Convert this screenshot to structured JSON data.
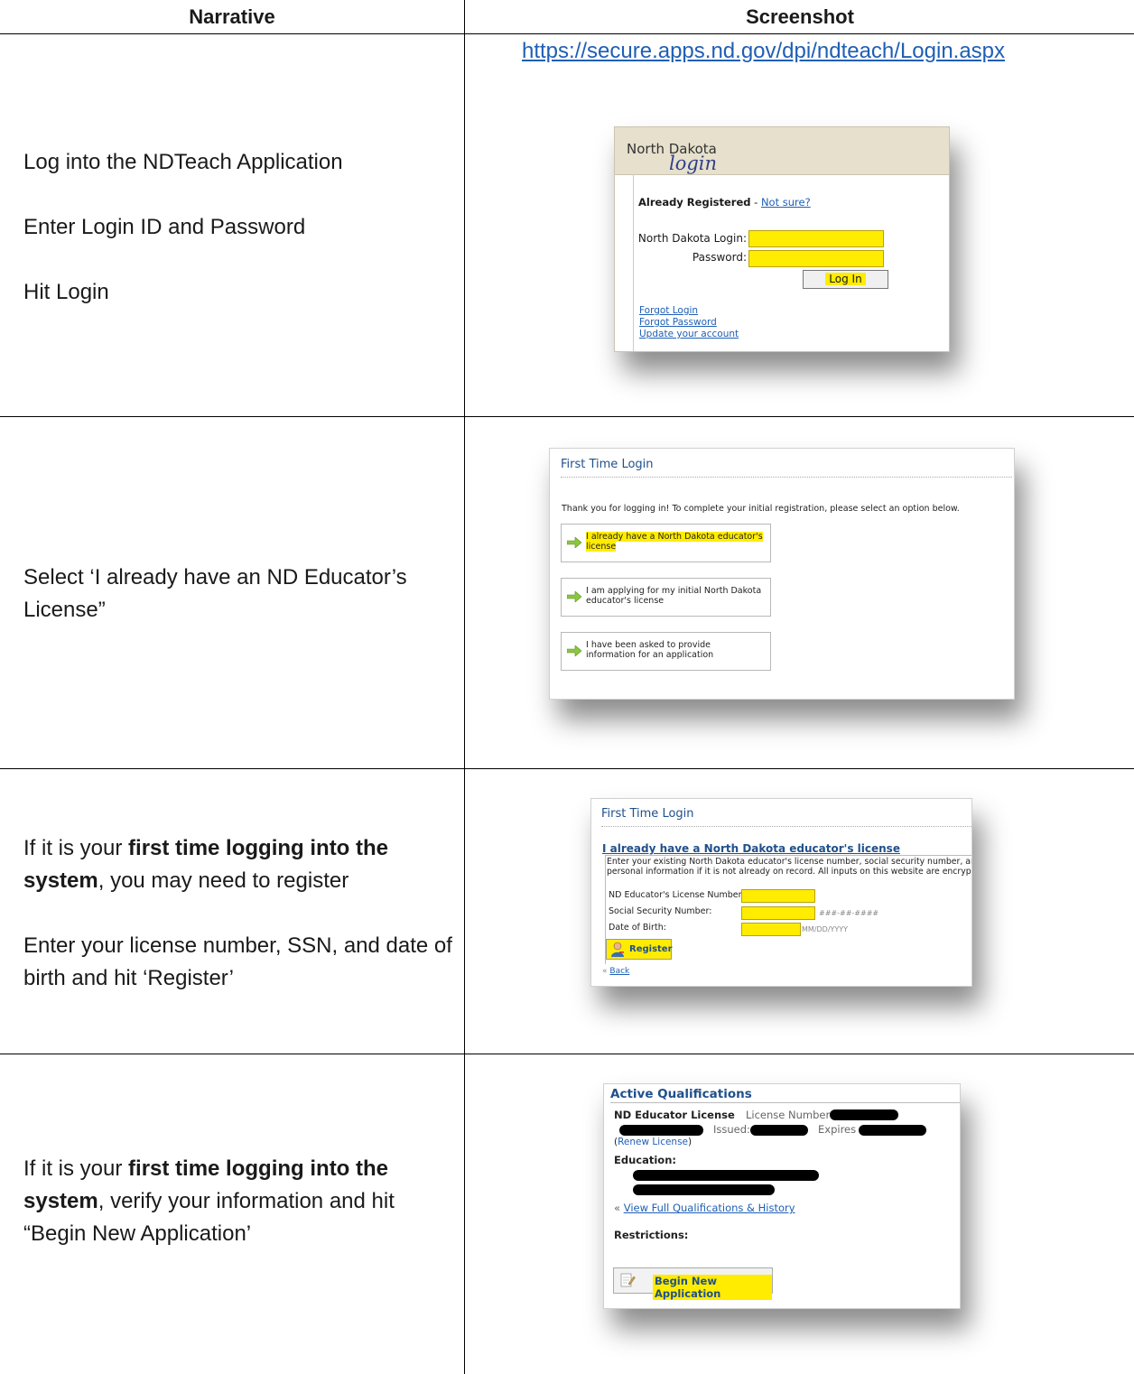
{
  "table": {
    "col_narrative": "Narrative",
    "col_screenshot": "Screenshot"
  },
  "rows": [
    {
      "narrative": [
        "Log into the NDTeach Application",
        "Enter Login ID and Password",
        "Hit Login"
      ],
      "url": "https://secure.apps.nd.gov/dpi/ndteach/Login.aspx"
    },
    {
      "narrative": "Select ‘I already have an ND Educator’s License”"
    },
    {
      "narrative_p1_pre": "If it is your ",
      "narrative_p1_bold": "first time logging into the system",
      "narrative_p1_post": ", you may need to register",
      "narrative_p2": "Enter your license number, SSN, and date of birth and hit ‘Register’"
    },
    {
      "narrative_pre": "If it is your ",
      "narrative_bold": "first time logging into the system",
      "narrative_post": ", verify your information and hit “Begin New Application’"
    }
  ],
  "login_shot": {
    "brand_line1": "North Dakota",
    "brand_line2": "login",
    "already_registered": "Already Registered",
    "separator": " - ",
    "not_sure": "Not sure?",
    "login_label": "North Dakota Login:",
    "password_label": "Password:",
    "login_button": "Log In",
    "forgot_login": "Forgot Login",
    "forgot_password": "Forgot Password",
    "update_account": "Update your account"
  },
  "first_login_shot": {
    "title": "First Time Login",
    "intro": "Thank you for logging in! To complete your initial registration, please select an option below.",
    "options": [
      {
        "line1": "I already have a North Dakota educator's",
        "line2": "license",
        "highlighted": true
      },
      {
        "line1": "I am applying for my initial North Dakota",
        "line2": "educator's license",
        "highlighted": false
      },
      {
        "line1": "I have been asked to provide",
        "line2": "information for an application",
        "highlighted": false
      }
    ]
  },
  "register_shot": {
    "title": "First Time Login",
    "section": "I already have a North Dakota educator's license",
    "desc_line1": "Enter your existing North Dakota educator's license number, social security number, an",
    "desc_line2": "personal information if it is not already on record. All inputs on this website are encryp",
    "license_label": "ND Educator's License Number:",
    "ssn_label": "Social Security Number:",
    "ssn_hint": "###-##-####",
    "dob_label": "Date of Birth:",
    "dob_hint": "MM/DD/YYYY",
    "register_button": "Register",
    "back_chevron": "«",
    "back_link": "Back"
  },
  "qualifications_shot": {
    "title": "Active Qualifications",
    "license_name": "ND Educator License",
    "license_number_label": "License Number",
    "issued_label": "Issued:",
    "expires_label": "Expires",
    "renew_open": "(",
    "renew_link": "Renew License",
    "renew_close": ")",
    "education_label": "Education:",
    "view_chevron": "«",
    "view_link": "View Full Qualifications & History",
    "restrictions_label": "Restrictions:",
    "begin_button": "Begin New Application"
  },
  "colors": {
    "highlight": "#ffec00",
    "link": "#1f5fb4",
    "heading_blue": "#20508c",
    "banner": "#e6e0cc"
  }
}
